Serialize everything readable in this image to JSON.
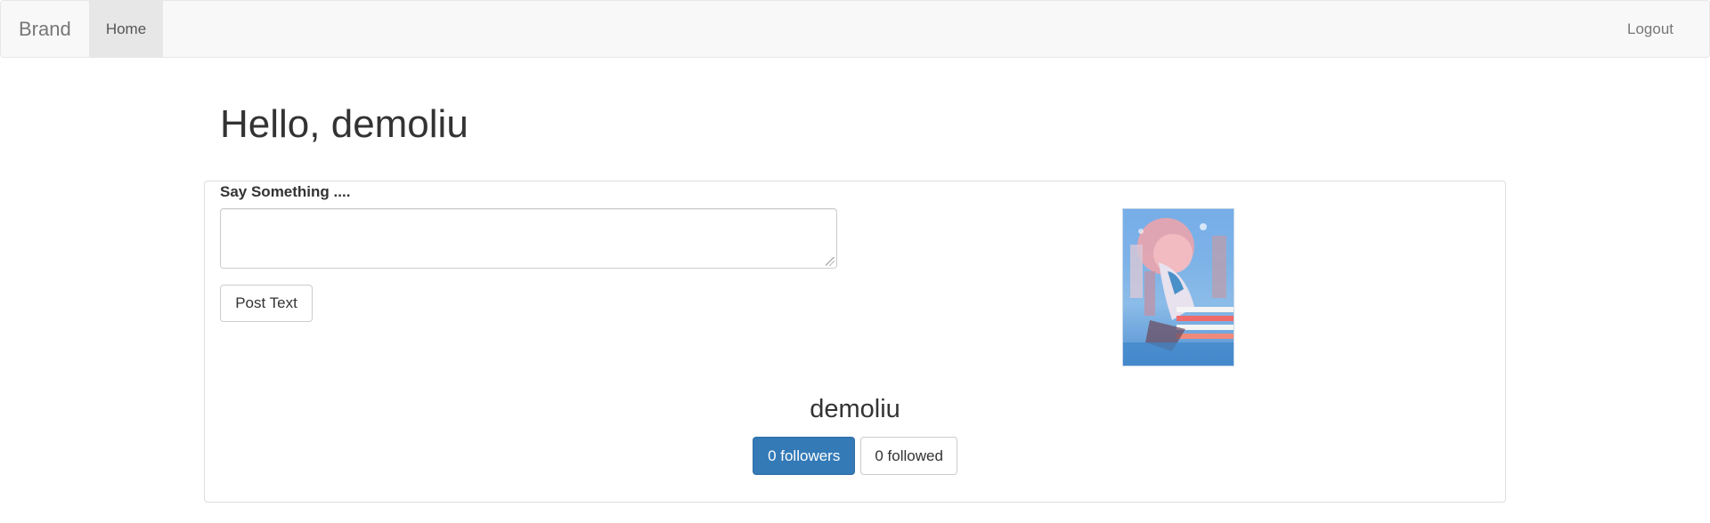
{
  "navbar": {
    "brand": "Brand",
    "home_label": "Home",
    "logout_label": "Logout"
  },
  "greeting": "Hello, demoliu",
  "post_form": {
    "label": "Say Something ....",
    "textarea_value": "",
    "submit_label": "Post Text"
  },
  "profile": {
    "username": "demoliu",
    "followers_label": "0 followers",
    "followed_label": "0 followed",
    "avatar_icon": "anime-illustration-avatar"
  },
  "colors": {
    "primary": "#337ab7",
    "navbar_bg": "#f8f8f8",
    "nav_active_bg": "#e7e7e7"
  }
}
